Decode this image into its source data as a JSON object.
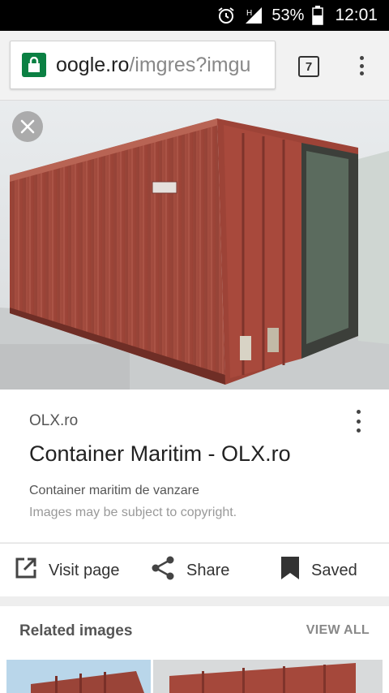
{
  "status_bar": {
    "battery": "53%",
    "time": "12:01",
    "network": "H"
  },
  "browser": {
    "url_host": "oogle.ro",
    "url_path": "/imgres?imgu",
    "tab_count": "7"
  },
  "result": {
    "site": "OLX.ro",
    "title": "Container Maritim - OLX.ro",
    "description": "Container maritim de vanzare",
    "copyright": "Images may be subject to copyright."
  },
  "actions": {
    "visit": "Visit page",
    "share": "Share",
    "saved": "Saved"
  },
  "related": {
    "title": "Related images",
    "view_all": "VIEW ALL"
  },
  "icons": [
    "alarm-icon",
    "signal-icon",
    "battery-icon",
    "lock-icon",
    "tabs-icon",
    "overflow-menu-icon",
    "close-icon",
    "open-in-new-icon",
    "share-icon",
    "bookmark-icon"
  ],
  "colors": {
    "accent_secure": "#0b8043",
    "container": "#a0453a"
  }
}
